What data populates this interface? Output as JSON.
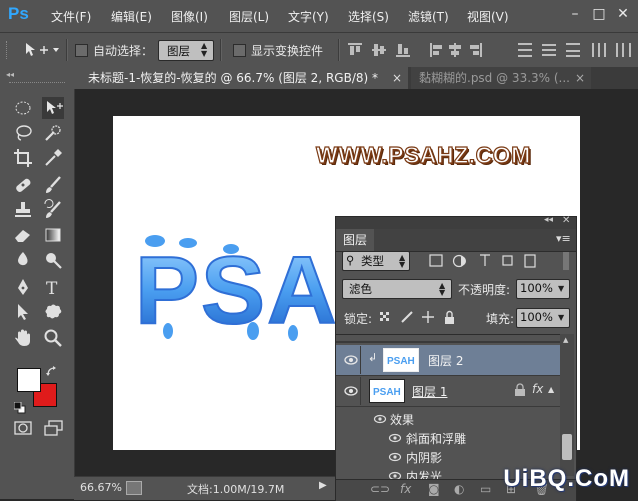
{
  "app": {
    "logo": "Ps"
  },
  "menu": {
    "items": [
      "文件(F)",
      "编辑(E)",
      "图像(I)",
      "图层(L)",
      "文字(Y)",
      "选择(S)",
      "滤镜(T)",
      "视图(V)"
    ]
  },
  "window_controls": {
    "minimize": "–",
    "maximize": "□",
    "close": "✕"
  },
  "options": {
    "auto_select_label": "自动选择：",
    "auto_select_value": "图层",
    "show_transform_label": "显示变换控件"
  },
  "tabs": [
    {
      "title": "未标题-1-恢复的-恢复的 @ 66.7% (图层 2, RGB/8) *",
      "close": "×"
    },
    {
      "title": "黏糊糊的.psd @ 33.3% (...",
      "close": "×"
    }
  ],
  "canvas": {
    "headline": "WWW.PSAHZ.COM",
    "effect_text": "PSAHZ"
  },
  "status": {
    "zoom": "66.67%",
    "doc": "文档:1.00M/19.7M"
  },
  "layers_panel": {
    "title": "图层",
    "filter_kind": "类型",
    "blend_mode": "滤色",
    "opacity_label": "不透明度:",
    "opacity_value": "100%",
    "lock_label": "锁定:",
    "fill_label": "填充:",
    "fill_value": "100%",
    "layers": [
      {
        "name": "图层 2",
        "selected": true
      },
      {
        "name": "图层 1",
        "selected": false
      }
    ],
    "effects_label": "效果",
    "effects": [
      "斜面和浮雕",
      "内阴影",
      "内发光"
    ],
    "fx_label": "fx"
  },
  "watermark": "UiBQ.CoM",
  "colors": {
    "panel_bg": "#535353",
    "workspace_bg": "#282828",
    "accent_blue": "#31a8ff",
    "foreground": "#ffffff",
    "background": "#e01b1b"
  },
  "icons": [
    "move-icon",
    "marquee-icon",
    "lasso-icon",
    "quick-select-icon",
    "crop-icon",
    "eyedropper-icon",
    "healing-brush-icon",
    "brush-icon",
    "stamp-icon",
    "history-brush-icon",
    "eraser-icon",
    "gradient-icon",
    "blur-icon",
    "dodge-icon",
    "pen-icon",
    "type-icon",
    "path-select-icon",
    "custom-shape-icon",
    "hand-icon",
    "zoom-icon",
    "eye-icon",
    "lock-icon"
  ]
}
